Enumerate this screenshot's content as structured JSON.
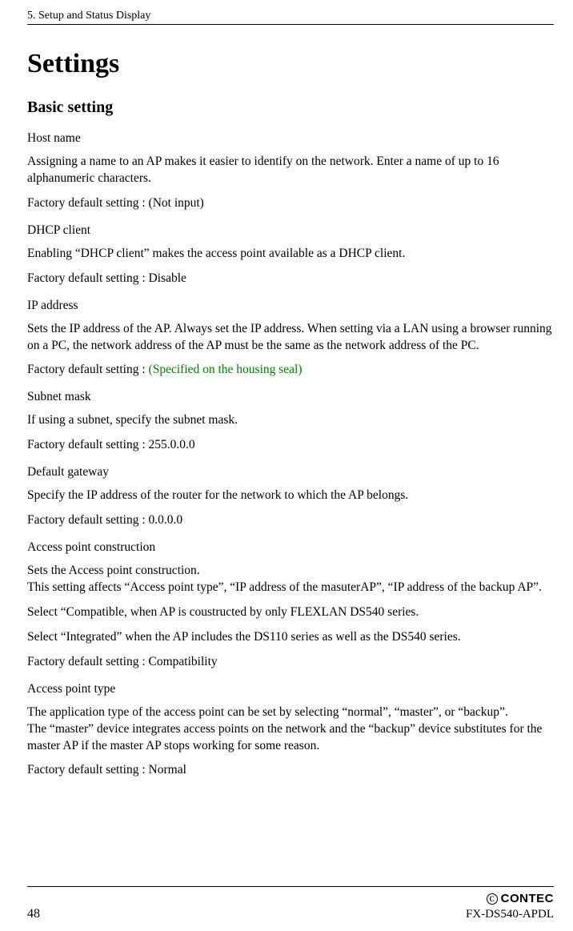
{
  "header": "5. Setup and Status Display",
  "title": "Settings",
  "section": "Basic setting",
  "items": [
    {
      "heading": "Host name",
      "paragraphs": [
        "Assigning a name to an AP makes it easier to identify on the network.  Enter a name of up to 16 alphanumeric characters."
      ],
      "default_prefix": "Factory default setting : ",
      "default_value": "(Not input)",
      "default_green": false
    },
    {
      "heading": "DHCP client",
      "paragraphs": [
        "Enabling “DHCP client” makes the access point available as a DHCP client."
      ],
      "default_prefix": "Factory default setting : ",
      "default_value": "Disable",
      "default_green": false
    },
    {
      "heading": "IP address",
      "paragraphs": [
        "Sets the IP address of the AP.  Always set the IP address.  When setting via a LAN using a browser running on a PC, the network address of the AP must be the same as the network address of the PC."
      ],
      "default_prefix": "Factory default setting : ",
      "default_value": "(Specified on the housing seal)",
      "default_green": true
    },
    {
      "heading": "Subnet mask",
      "paragraphs": [
        "If using a subnet, specify the subnet mask."
      ],
      "default_prefix": "Factory default setting : ",
      "default_value": "255.0.0.0",
      "default_green": false
    },
    {
      "heading": "Default gateway",
      "paragraphs": [
        "Specify the IP address of the router for the network to which the AP belongs."
      ],
      "default_prefix": "Factory default setting : ",
      "default_value": "0.0.0.0",
      "default_green": false
    },
    {
      "heading": "Access point construction",
      "paragraphs": [
        "Sets the Access point construction.\nThis setting affects “Access point type”, “IP address of the masuterAP”, “IP address of the backup AP”.",
        "Select “Compatible, when AP is coustructed by only FLEXLAN DS540 series.",
        "Select “Integrated” when the AP includes the DS110 series as well as the DS540 series."
      ],
      "default_prefix": "Factory default setting : ",
      "default_value": "Compatibility",
      "default_green": false
    },
    {
      "heading": "Access point type",
      "paragraphs": [
        "The application type of the access point can be set by selecting “normal”, “master”, or “backup”.\nThe “master” device integrates access points on the network and the “backup” device substitutes for the master AP if the master AP stops working for some reason."
      ],
      "default_prefix": "Factory default setting : ",
      "default_value": "Normal",
      "default_green": false
    }
  ],
  "footer": {
    "page": "48",
    "brand": "CONTEC",
    "brand_inner": "C",
    "model": "FX-DS540-APDL"
  }
}
